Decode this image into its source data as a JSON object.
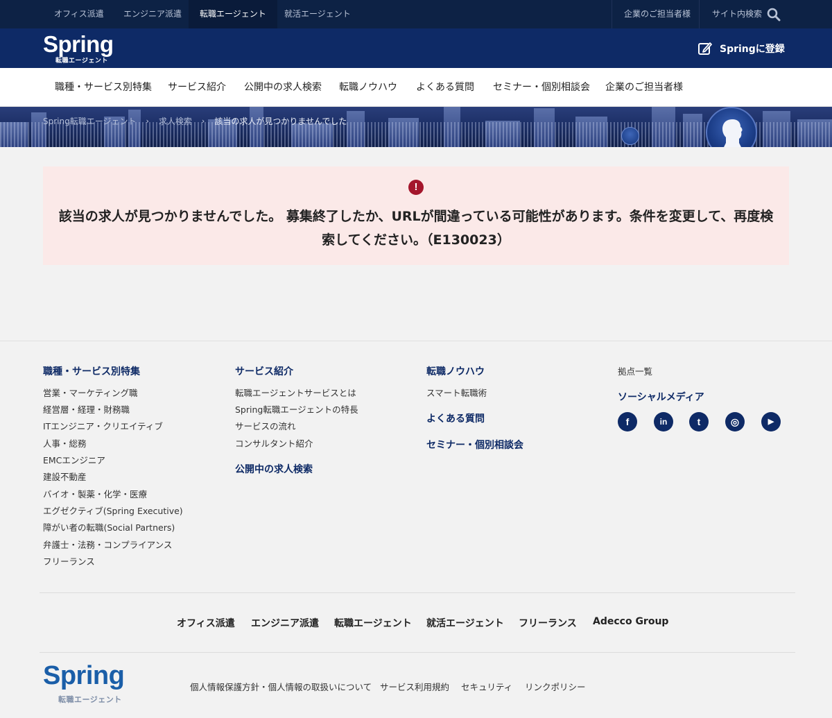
{
  "topbar": {
    "tabs": [
      {
        "label": "オフィス派遣"
      },
      {
        "label": "エンジニア派遣"
      },
      {
        "label": "転職エージェント",
        "active": true
      },
      {
        "label": "就活エージェント"
      }
    ],
    "corporate_label": "企業のご担当者様",
    "site_search_label": "サイト内検索",
    "search_icon": "search-icon"
  },
  "header": {
    "logo_text": "Spring",
    "logo_sub": "転職エージェント",
    "register_label": "Springに登録",
    "register_icon": "edit-icon"
  },
  "gnav": {
    "items": [
      {
        "label": "職種・サービス別特集"
      },
      {
        "label": "サービス紹介"
      },
      {
        "label": "公開中の求人検索"
      },
      {
        "label": "転職ノウハウ"
      },
      {
        "label": "よくある質問"
      },
      {
        "label": "セミナー・個別相談会"
      },
      {
        "label": "企業のご担当者様"
      }
    ]
  },
  "breadcrumb": {
    "items": [
      {
        "label": "Spring転職エージェント"
      },
      {
        "label": "求人検索"
      },
      {
        "label": "該当の求人が見つかりませんでした"
      }
    ]
  },
  "alert": {
    "icon": "exclamation-circle-icon",
    "message": "該当の求人が見つかりませんでした。 募集終了したか、URLが間違っている可能性があります。条件を変更して、再度検索してください。（E130023）"
  },
  "footer": {
    "col1": {
      "heading": "職種・サービス別特集",
      "links": [
        "営業・マーケティング職",
        "経営層・経理・財務職",
        "ITエンジニア・クリエイティブ",
        "人事・総務",
        "EMCエンジニア",
        "建設不動産",
        "バイオ・製薬・化学・医療",
        "エグゼクティブ(Spring Executive)",
        "障がい者の転職(Social Partners)",
        "弁護士・法務・コンプライアンス",
        "フリーランス"
      ]
    },
    "col2": {
      "heading": "サービス紹介",
      "links": [
        "転職エージェントサービスとは",
        "Spring転職エージェントの特長",
        "サービスの流れ",
        "コンサルタント紹介"
      ],
      "heading2": "公開中の求人検索"
    },
    "col3": {
      "heading": "転職ノウハウ",
      "links": [
        "スマート転職術"
      ],
      "heading2": "よくある質問",
      "heading3": "セミナー・個別相談会"
    },
    "col4": {
      "link": "拠点一覧",
      "social_heading": "ソーシャルメディア",
      "social": [
        {
          "icon": "facebook-icon",
          "glyph": "f"
        },
        {
          "icon": "linkedin-icon",
          "glyph": "in"
        },
        {
          "icon": "twitter-icon",
          "glyph": "t"
        },
        {
          "icon": "instagram-icon",
          "glyph": "◎"
        },
        {
          "icon": "youtube-icon",
          "glyph": "▶"
        }
      ]
    },
    "bottom_nav": [
      "オフィス派遣",
      "エンジニア派遣",
      "転職エージェント",
      "就活エージェント",
      "フリーランス",
      "Adecco Group"
    ],
    "logo_text": "Spring",
    "logo_sub": "転職エージェント",
    "legal_links": [
      "個人情報保護方針・個人情報の取扱いについて",
      "サービス利用規約",
      "セキュリティ",
      "リンクポリシー"
    ]
  },
  "colors": {
    "topbar_bg": "#0d2245",
    "header_bg": "#0e2a66",
    "alert_bg": "#fbe9e8",
    "alert_icon": "#a4162c",
    "footer_heading": "#0e2a66",
    "logo_blue": "#1a5ea8"
  }
}
